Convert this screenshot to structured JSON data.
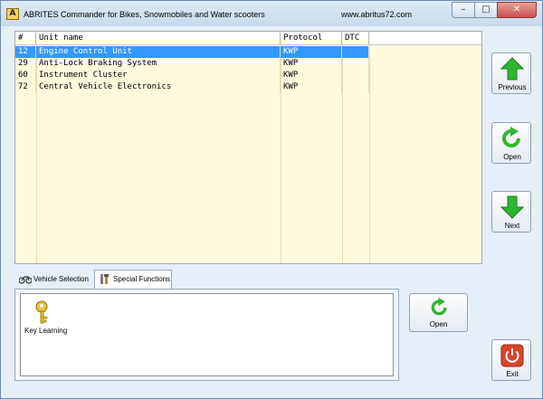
{
  "window": {
    "title": "ABRITES Commander for Bikes, Snowmobiles and Water scooters",
    "url": "www.abritus72.com",
    "app_icon_letter": "A"
  },
  "grid": {
    "headers": [
      "#",
      "Unit name",
      "Protocol",
      "DTC"
    ],
    "rows": [
      {
        "num": "12",
        "name": "Engine Control Unit",
        "protocol": "KWP",
        "dtc": "",
        "selected": true
      },
      {
        "num": "29",
        "name": "Anti-Lock Braking System",
        "protocol": "KWP",
        "dtc": "",
        "selected": false
      },
      {
        "num": "60",
        "name": "Instrument Cluster",
        "protocol": "KWP",
        "dtc": "",
        "selected": false
      },
      {
        "num": "72",
        "name": "Central Vehicle Electronics",
        "protocol": "KWP",
        "dtc": "",
        "selected": false
      }
    ]
  },
  "buttons": {
    "previous": "Previous",
    "open": "Open",
    "next": "Next",
    "exit": "Exit",
    "panel_open": "Open"
  },
  "tabs": [
    {
      "label": "Vehicle Selection",
      "icon": "motorcycle-icon",
      "active": false
    },
    {
      "label": "Special Functions",
      "icon": "tools-icon",
      "active": true
    }
  ],
  "functions": [
    {
      "label": "Key Learning",
      "icon": "key-icon"
    }
  ],
  "colors": {
    "selection": "#3399ff",
    "grid_background": "#fdfbdc",
    "arrow_green": "#2fb52f",
    "exit_red": "#d9442a"
  }
}
